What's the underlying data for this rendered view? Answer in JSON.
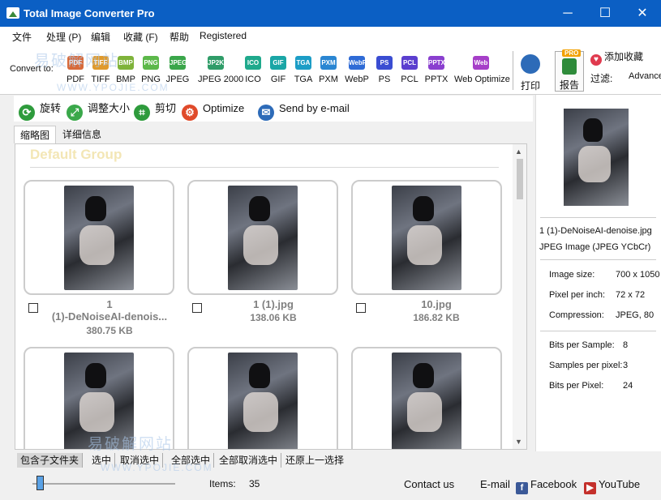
{
  "window": {
    "title": "Total Image Converter Pro",
    "minimize": "─",
    "maximize": "☐",
    "close": "✕"
  },
  "menu": [
    "文件",
    "处理 (P)",
    "编辑",
    "收藏 (F)",
    "帮助",
    "Registered"
  ],
  "toolbar": {
    "convert_label": "Convert to:",
    "formats": [
      {
        "icon": "PDF",
        "label": "PDF",
        "color": "#d86a3a"
      },
      {
        "icon": "TIFF",
        "label": "TIFF",
        "color": "#e09a2c"
      },
      {
        "icon": "BMP",
        "label": "BMP",
        "color": "#7fb33a"
      },
      {
        "icon": "PNG",
        "label": "PNG",
        "color": "#5cb84a"
      },
      {
        "icon": "JPEG",
        "label": "JPEG",
        "color": "#3aa64a"
      },
      {
        "icon": "JP2K",
        "label": "JPEG 2000",
        "color": "#2f9c68"
      },
      {
        "icon": "ICO",
        "label": "ICO",
        "color": "#1fa98c"
      },
      {
        "icon": "GIF",
        "label": "GIF",
        "color": "#1aa6a6"
      },
      {
        "icon": "TGA",
        "label": "TGA",
        "color": "#1c9dc6"
      },
      {
        "icon": "PXM",
        "label": "PXM",
        "color": "#2a86d2"
      },
      {
        "icon": "WebP",
        "label": "WebP",
        "color": "#2f6bd6"
      },
      {
        "icon": "PS",
        "label": "PS",
        "color": "#3a4dd2"
      },
      {
        "icon": "PCL",
        "label": "PCL",
        "color": "#5b3fcf"
      },
      {
        "icon": "PPTX",
        "label": "PPTX",
        "color": "#8a3fcf"
      },
      {
        "icon": "Web",
        "label": "Web Optimize",
        "color": "#a63fc8"
      }
    ],
    "print_label": "打印",
    "report_label": "报告",
    "report_badge": "PRO",
    "favorite_label": "添加收藏",
    "filter_label": "过滤:",
    "filter_value": "Advanced"
  },
  "actions": [
    {
      "label": "旋转",
      "icon": "rotate-icon",
      "glyph": "⟳",
      "color": "#2e9b3c"
    },
    {
      "label": "调整大小",
      "icon": "resize-icon",
      "glyph": "⤢",
      "color": "#3aa84a"
    },
    {
      "label": "剪切",
      "icon": "crop-icon",
      "glyph": "⌗",
      "color": "#2e9b3c"
    },
    {
      "label": "Optimize",
      "icon": "optimize-gear-icon",
      "glyph": "⚙",
      "color": "#e04a2a"
    },
    {
      "label": "Send by e-mail",
      "icon": "email-icon",
      "glyph": "✉",
      "color": "#2d6bb8"
    }
  ],
  "tabs": [
    "缩略图",
    "详细信息"
  ],
  "gallery": {
    "group_title": "Default Group",
    "items": [
      {
        "line1": "1",
        "line2": "(1)-DeNoiseAI-denois...",
        "size": "380.75 KB"
      },
      {
        "line1": "1 (1).jpg",
        "line2": "",
        "size": "138.06 KB"
      },
      {
        "line1": "10.jpg",
        "line2": "",
        "size": "186.82 KB"
      },
      {
        "line1": "",
        "line2": "",
        "size": ""
      },
      {
        "line1": "",
        "line2": "",
        "size": ""
      },
      {
        "line1": "",
        "line2": "",
        "size": ""
      }
    ]
  },
  "bottom_actions": [
    "包含子文件夹",
    "选中",
    "取消选中",
    "全部选中",
    "全部取消选中",
    "还原上一选择"
  ],
  "status": {
    "items_label": "Items:",
    "items_count": "35",
    "contact": "Contact us",
    "email": "E-mail",
    "facebook": "Facebook",
    "youtube": "YouTube"
  },
  "zoom": {
    "level": 0.03
  },
  "info_panel": {
    "filename": "1 (1)-DeNoiseAI-denoise.jpg",
    "filetype": "JPEG Image (JPEG YCbCr)",
    "rows": [
      {
        "label": "Image size:",
        "value": "700 x 1050"
      },
      {
        "label": "Pixel per inch:",
        "value": "72 x 72"
      },
      {
        "label": "Compression:",
        "value": "JPEG, 80"
      },
      {
        "label": "Bits per Sample:",
        "value": "8"
      },
      {
        "label": "Samples per pixel:",
        "value": "3"
      },
      {
        "label": "Bits per Pixel:",
        "value": "24"
      }
    ]
  },
  "watermarks": [
    "易破解网站",
    "WWW.YPOJIE.COM",
    "易破解网站",
    "WWW.YPOJIE.COM"
  ]
}
